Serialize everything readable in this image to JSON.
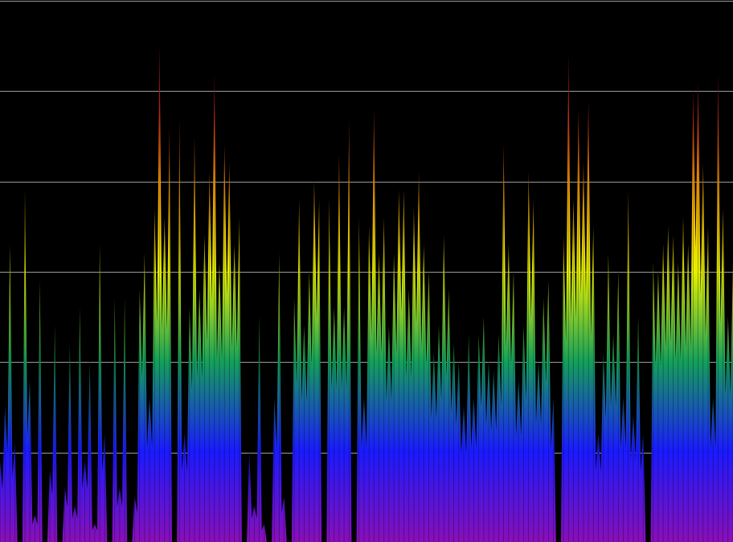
{
  "chart_data": {
    "type": "area",
    "title": "",
    "xlabel": "",
    "ylabel": "",
    "grid": true,
    "gridlines": 6,
    "ylim": [
      0,
      6
    ],
    "gradient_stops": [
      "#8a0fb8",
      "#1a1aff",
      "#14a05a",
      "#e6f000",
      "#ff9a00",
      "#e61a2a",
      "#cc1a7a"
    ],
    "background": "#000000",
    "gridline_color": "#9a9a9a",
    "series": [
      {
        "values": [
          0.9,
          1.5,
          3.3,
          1.1,
          0.0,
          3.9,
          1.8,
          0.3,
          2.9,
          0.0,
          0.8,
          2.4,
          0.0,
          0.6,
          2.2,
          0.4,
          2.6,
          0.9,
          2.0,
          0.2,
          3.3,
          1.2,
          0.0,
          2.7,
          0.6,
          2.7,
          0.0,
          0.5,
          2.8,
          3.2,
          1.6,
          3.7,
          5.5,
          3.6,
          4.6,
          0.0,
          4.7,
          1.2,
          2.6,
          4.5,
          2.8,
          3.4,
          4.1,
          5.2,
          3.1,
          4.4,
          4.2,
          3.3,
          3.6,
          0.0,
          1.0,
          0.4,
          2.5,
          0.2,
          0.0,
          1.6,
          3.2,
          0.5,
          0.0,
          2.7,
          3.8,
          2.4,
          3.0,
          4.0,
          3.8,
          0.0,
          3.8,
          2.6,
          4.3,
          2.6,
          4.7,
          0.0,
          3.6,
          1.6,
          3.5,
          4.8,
          3.2,
          3.6,
          2.4,
          3.2,
          3.9,
          3.9,
          2.8,
          3.7,
          4.1,
          3.3,
          3.0,
          2.1,
          2.4,
          3.4,
          2.8,
          2.2,
          2.0,
          1.5,
          2.3,
          1.6,
          2.3,
          2.5,
          2.0,
          1.9,
          2.3,
          4.4,
          3.3,
          3.0,
          1.8,
          2.4,
          4.1,
          3.8,
          2.0,
          2.7,
          2.9,
          1.6,
          0.0,
          3.4,
          5.4,
          3.8,
          4.8,
          4.2,
          4.9,
          3.5,
          1.2,
          2.1,
          3.2,
          2.3,
          3.0,
          1.6,
          3.9,
          1.4,
          2.5,
          1.2,
          0.0,
          3.1,
          3.0,
          3.3,
          3.5,
          3.4,
          3.1,
          3.6,
          3.3,
          5.0,
          5.1,
          4.2,
          3.5,
          1.6,
          5.2,
          3.7,
          2.5,
          3.1
        ]
      }
    ]
  }
}
